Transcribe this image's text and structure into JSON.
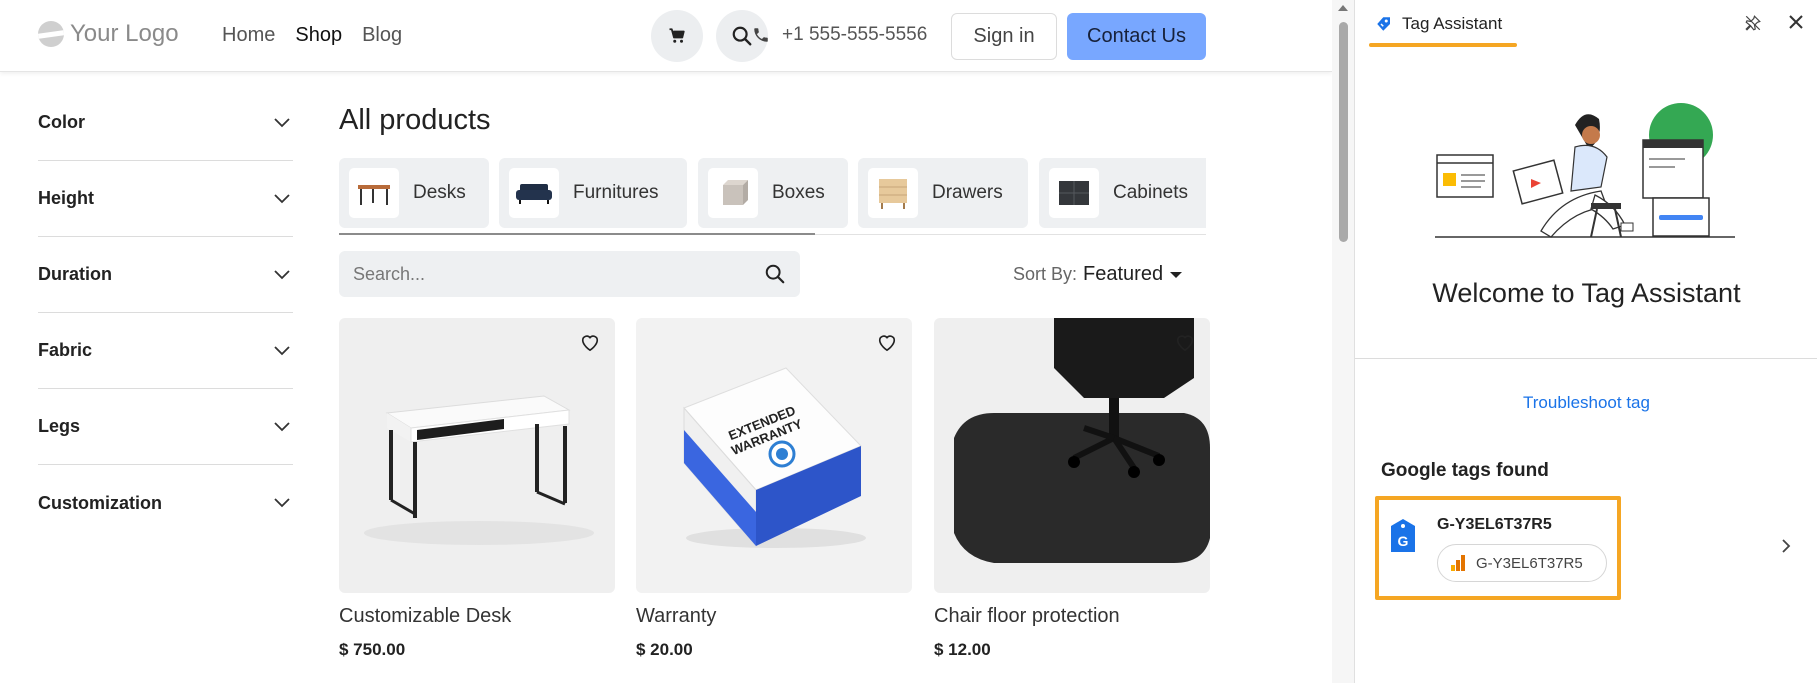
{
  "header": {
    "logo_text": "Your Logo",
    "nav": [
      "Home",
      "Shop",
      "Blog"
    ],
    "active_nav": "Shop",
    "phone": "+1 555-555-5556",
    "sign_in": "Sign in",
    "contact": "Contact Us"
  },
  "filters": [
    "Color",
    "Height",
    "Duration",
    "Fabric",
    "Legs",
    "Customization"
  ],
  "main": {
    "title": "All products",
    "categories": [
      "Desks",
      "Furnitures",
      "Boxes",
      "Drawers",
      "Cabinets"
    ],
    "search_placeholder": "Search...",
    "sort_label": "Sort By:",
    "sort_value": "Featured"
  },
  "products": [
    {
      "name": "Customizable Desk",
      "price": "$ 750.00"
    },
    {
      "name": "Warranty",
      "price": "$ 20.00"
    },
    {
      "name": "Chair floor protection",
      "price": "$ 12.00"
    }
  ],
  "warranty_box_text": "EXTENDED WARRANTY",
  "panel": {
    "title": "Tag Assistant",
    "welcome": "Welcome to Tag Assistant",
    "troubleshoot": "Troubleshoot tag",
    "tags_found_title": "Google tags found",
    "tag_id": "G-Y3EL6T37R5",
    "tag_chip": "G-Y3EL6T37R5"
  },
  "colors": {
    "accent": "#78a7ff",
    "highlight": "#f5a623",
    "link": "#1a73e8",
    "success_green": "#34a853"
  }
}
